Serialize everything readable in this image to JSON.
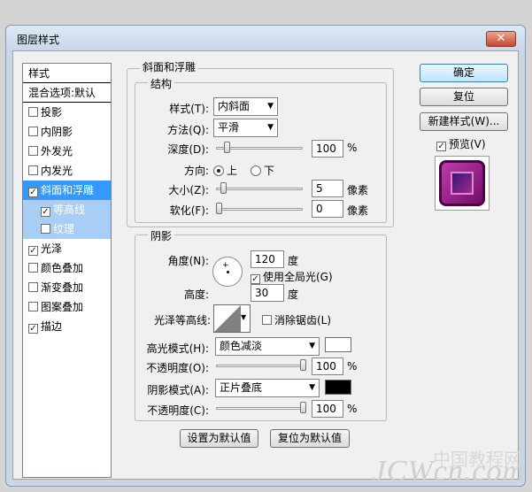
{
  "window": {
    "title": "图层样式",
    "close": "✕"
  },
  "sidebar": {
    "header": "样式",
    "items": [
      {
        "label": "混合选项:默认",
        "checkbox": false,
        "checked": false,
        "state": "normal"
      },
      {
        "label": "投影",
        "checkbox": true,
        "checked": false,
        "state": "normal"
      },
      {
        "label": "内阴影",
        "checkbox": true,
        "checked": false,
        "state": "normal"
      },
      {
        "label": "外发光",
        "checkbox": true,
        "checked": false,
        "state": "normal"
      },
      {
        "label": "内发光",
        "checkbox": true,
        "checked": false,
        "state": "normal"
      },
      {
        "label": "斜面和浮雕",
        "checkbox": true,
        "checked": true,
        "state": "selected"
      },
      {
        "label": "等高线",
        "checkbox": true,
        "checked": true,
        "state": "sub"
      },
      {
        "label": "纹理",
        "checkbox": true,
        "checked": false,
        "state": "sub"
      },
      {
        "label": "光泽",
        "checkbox": true,
        "checked": true,
        "state": "normal"
      },
      {
        "label": "颜色叠加",
        "checkbox": true,
        "checked": false,
        "state": "normal"
      },
      {
        "label": "渐变叠加",
        "checkbox": true,
        "checked": false,
        "state": "normal"
      },
      {
        "label": "图案叠加",
        "checkbox": true,
        "checked": false,
        "state": "normal"
      },
      {
        "label": "描边",
        "checkbox": true,
        "checked": true,
        "state": "normal"
      }
    ]
  },
  "bevel": {
    "group_title": "斜面和浮雕",
    "structure_title": "结构",
    "style_label": "样式(T):",
    "style_value": "内斜面",
    "technique_label": "方法(Q):",
    "technique_value": "平滑",
    "depth_label": "深度(D):",
    "depth_value": "100",
    "depth_unit": "%",
    "depth_level": 0.1,
    "direction_label": "方向:",
    "dir_up": "上",
    "dir_down": "下",
    "size_label": "大小(Z):",
    "size_value": "5",
    "size_unit": "像素",
    "size_level": 0.05,
    "soften_label": "软化(F):",
    "soften_value": "0",
    "soften_unit": "像素",
    "soften_level": 0.0
  },
  "shading": {
    "title": "阴影",
    "angle_label": "角度(N):",
    "angle_value": "120",
    "angle_unit": "度",
    "global_light_label": "使用全局光(G)",
    "global_light_checked": true,
    "altitude_label": "高度:",
    "altitude_value": "30",
    "altitude_unit": "度",
    "gloss_label": "光泽等高线:",
    "antialias_label": "消除锯齿(L)",
    "antialias_checked": false,
    "highlight_label": "高光模式(H):",
    "highlight_mode": "颜色减淡",
    "highlight_color": "#ffffff",
    "opacity1_label": "不透明度(O):",
    "opacity1_value": "100",
    "opacity1_unit": "%",
    "shadow_label": "阴影模式(A):",
    "shadow_mode": "正片叠底",
    "shadow_color": "#000000",
    "opacity2_label": "不透明度(C):",
    "opacity2_value": "100",
    "opacity2_unit": "%"
  },
  "buttons": {
    "ok": "确定",
    "reset": "复位",
    "new_style": "新建样式(W)...",
    "preview": "预览(V)",
    "make_default": "设置为默认值",
    "reset_default": "复位为默认值"
  },
  "watermark": {
    "cn": "中国教程网",
    "en": "JCWcn.com"
  },
  "colors": {
    "accent": "#3399ff",
    "sub_highlight": "#a9cef5",
    "preview_purple": "#8b1a7a"
  }
}
